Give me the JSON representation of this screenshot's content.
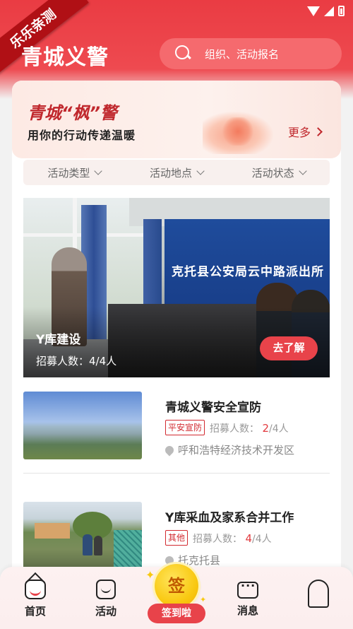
{
  "ribbon": "乐乐亲测",
  "header": {
    "title": "青城义警",
    "search_placeholder": "组织、活动报名"
  },
  "banner": {
    "title": "青城“枫”警",
    "subtitle": "用你的行动传递温暖",
    "more_label": "更多"
  },
  "filters": [
    {
      "label": "活动类型"
    },
    {
      "label": "活动地点"
    },
    {
      "label": "活动状态"
    }
  ],
  "featured": {
    "wall_sign": "克托县公安局云中路派出所",
    "title": "Y库建设",
    "count_label": "招募人数：",
    "count_value": "4/4人",
    "button_label": "去了解"
  },
  "activities": [
    {
      "title": "青城义警安全宣防",
      "tag": "平安宣防",
      "recruit_label": "招募人数：",
      "recruited": "2",
      "total": "/4人",
      "location": "呼和浩特经济技术开发区"
    },
    {
      "title": "Y库采血及家系合并工作",
      "tag": "其他",
      "recruit_label": "招募人数：",
      "recruited": "4",
      "total": "/4人",
      "location": "托克托县"
    }
  ],
  "tabbar": {
    "home": "首页",
    "activity": "活动",
    "sign_icon": "签",
    "sign_label": "签到啦",
    "message": "消息"
  },
  "colors": {
    "primary": "#ea3c43",
    "accent_red": "#c0282d",
    "sign_yellow": "#f9c912"
  }
}
